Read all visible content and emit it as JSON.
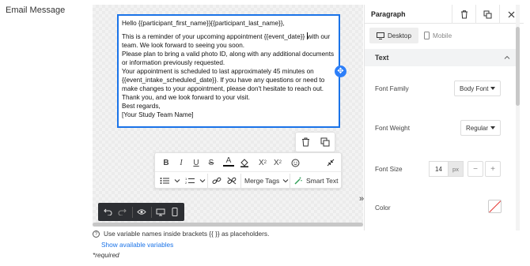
{
  "field_label": "Email Message",
  "email_body": {
    "greeting": "Hello {{participant_first_name}}{{participant_last_name}},",
    "line1a": "This is a reminder of your upcoming appointment {{event_date}}",
    "line1b": "with our team. We look forward to seeing you soon.",
    "line2": "Please plan to bring a valid photo ID, along with any additional documents or information previously requested.",
    "line3": "Your appointment is scheduled to last approximately 45 minutes on {{event_intake_scheduled_date}}. If you have any questions or need to make changes to your appointment, please don't hesitate to reach out.",
    "line4": "Thank you, and we look forward to your visit.",
    "line5": "Best regards,",
    "line6": "[Your Study Team Name]"
  },
  "format_toolbar": {
    "bold": "B",
    "italic": "I",
    "underline": "U",
    "strikethrough": "S",
    "text_color": "A",
    "subscript_base": "X",
    "subscript_mark": "2",
    "superscript_base": "X",
    "superscript_mark": "2",
    "merge_tags_label": "Merge Tags",
    "smart_text_label": "Smart Text"
  },
  "hint_text": "Use variable names inside brackets {{ }} as placeholders.",
  "show_variables_link": "Show available variables",
  "required_text": "*required",
  "panel": {
    "title": "Paragraph",
    "tabs": {
      "desktop": "Desktop",
      "mobile": "Mobile"
    },
    "section_title": "Text",
    "font_family_label": "Font Family",
    "font_family_value": "Body Font",
    "font_weight_label": "Font Weight",
    "font_weight_value": "Regular",
    "font_size_label": "Font Size",
    "font_size_value": "14",
    "font_size_unit": "px",
    "color_label": "Color"
  },
  "colors": {
    "accent": "#1a73e8",
    "handle": "#2d7ff9",
    "dark_toolbar": "#2d2f33",
    "swatch_slash": "#e53935"
  }
}
